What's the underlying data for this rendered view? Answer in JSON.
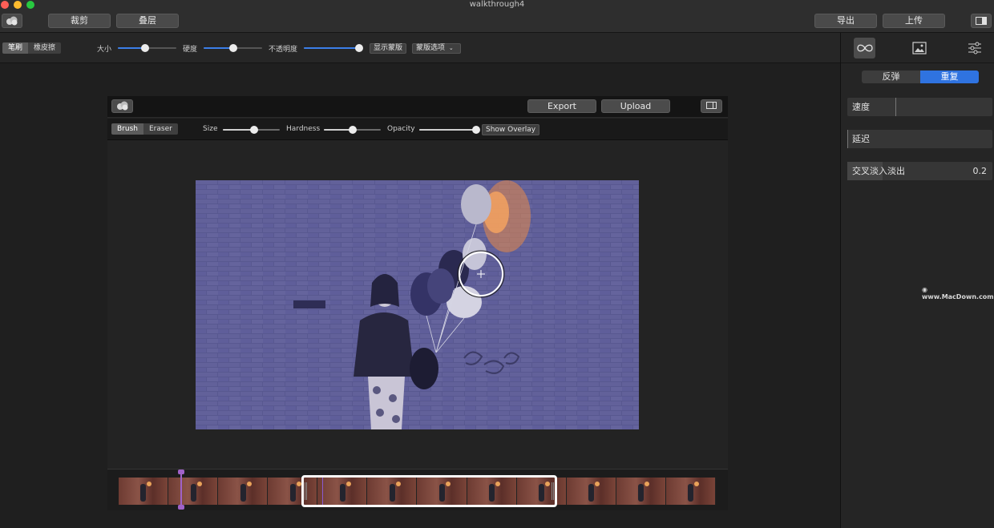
{
  "window": {
    "title": "walkthrough4"
  },
  "titlebar": {
    "crop_label": "裁剪",
    "layers_label": "叠层",
    "export_label": "导出",
    "upload_label": "上传"
  },
  "toolrow": {
    "brush_label": "笔刷",
    "eraser_label": "橡皮擦",
    "size_label": "大小",
    "size_value": 0.47,
    "hardness_label": "硬度",
    "hardness_value": 0.5,
    "opacity_label": "不透明度",
    "opacity_value": 1.0,
    "show_mask_label": "显示蒙版",
    "mask_options_label": "蒙版选项"
  },
  "inner": {
    "export_label": "Export",
    "upload_label": "Upload",
    "brush_label": "Brush",
    "eraser_label": "Eraser",
    "size_label": "Size",
    "size_value": 0.55,
    "hardness_label": "Hardness",
    "hardness_value": 0.5,
    "opacity_label": "Opacity",
    "opacity_value": 1.0,
    "show_overlay_label": "Show Overlay"
  },
  "right_panel": {
    "bounce_label": "反弹",
    "repeat_label": "重复",
    "speed_label": "速度",
    "delay_label": "延迟",
    "crossfade_label": "交叉淡入淡出",
    "crossfade_value": "0.2"
  },
  "watermark": "www.MacDown.com",
  "colors": {
    "accent": "#2f73e0",
    "slider": "#3b7ee8",
    "playhead": "#a062c8"
  }
}
